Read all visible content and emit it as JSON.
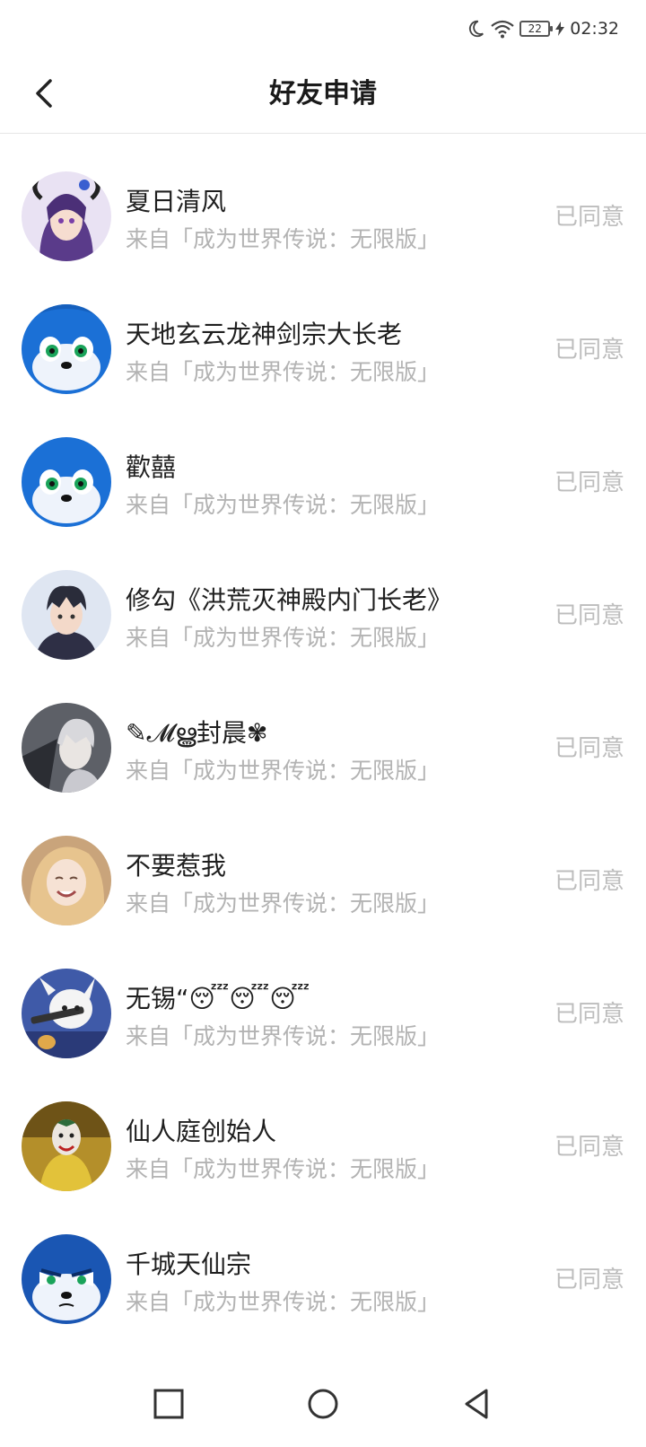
{
  "status_bar": {
    "battery": "22",
    "time": "02:32",
    "icons": [
      "moon-icon",
      "wifi-icon",
      "battery-icon",
      "charging-icon"
    ]
  },
  "header": {
    "title": "好友申请",
    "back_icon": "chevron-left-icon"
  },
  "requests": [
    {
      "name": "夏日清风",
      "source": "来自「成为世界传说：无限版」",
      "status": "已同意",
      "avatar": "anime-girl-avatar",
      "color": "#6b4aa0"
    },
    {
      "name": "天地玄云龙神剑宗大长老",
      "source": "来自「成为世界传说：无限版」",
      "status": "已同意",
      "avatar": "blue-hedgehog-avatar",
      "color": "#1f6fd1"
    },
    {
      "name": "歡囍",
      "source": "来自「成为世界传说：无限版」",
      "status": "已同意",
      "avatar": "blue-hedgehog-avatar",
      "color": "#1f6fd1"
    },
    {
      "name": "修勾《洪荒灭神殿内门长老》",
      "source": "来自「成为世界传说：无限版」",
      "status": "已同意",
      "avatar": "anime-boy-avatar",
      "color": "#3a3f63"
    },
    {
      "name": "✎𝓜ൠ封晨✾",
      "source": "来自「成为世界传说：无限版」",
      "status": "已同意",
      "avatar": "silver-hair-avatar",
      "color": "#7d8088"
    },
    {
      "name": "不要惹我",
      "source": "来自「成为世界传说：无限版」",
      "status": "已同意",
      "avatar": "blonde-girl-avatar",
      "color": "#d9b38a"
    },
    {
      "name": "无锡“😴😴😴",
      "source": "来自「成为世界传说：无限版」",
      "status": "已同意",
      "avatar": "game-character-avatar",
      "color": "#3c4a8c"
    },
    {
      "name": "仙人庭创始人",
      "source": "来自「成为世界传说：无限版」",
      "status": "已同意",
      "avatar": "joker-avatar",
      "color": "#b8922a"
    },
    {
      "name": "千城天仙宗",
      "source": "来自「成为世界传说：无限版」",
      "status": "已同意",
      "avatar": "blue-hedgehog-angry-avatar",
      "color": "#1b5bb8"
    }
  ],
  "nav_bar": {
    "recent": "square-icon",
    "home": "circle-icon",
    "back": "triangle-back-icon"
  }
}
